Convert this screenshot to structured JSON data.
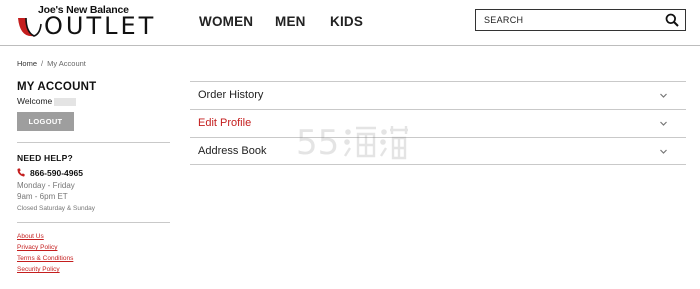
{
  "brand": {
    "line1": "Joe's New Balance",
    "line2": "OUTLET",
    "accent_color": "#c41e1e"
  },
  "nav": {
    "items": [
      {
        "label": "WOMEN"
      },
      {
        "label": "MEN"
      },
      {
        "label": "KIDS"
      }
    ]
  },
  "search": {
    "placeholder": "SEARCH",
    "icon": "search-icon"
  },
  "breadcrumb": {
    "home": "Home",
    "separator": "/",
    "current": "My Account"
  },
  "sidebar": {
    "title": "MY ACCOUNT",
    "welcome": "Welcome",
    "logout_label": "LOGOUT",
    "help_title": "NEED HELP?",
    "phone": "866-590-4965",
    "hours_days": "Monday - Friday",
    "hours_time": "9am - 6pm ET",
    "closed": "Closed Saturday & Sunday",
    "links": [
      {
        "label": "About Us"
      },
      {
        "label": "Privacy Policy"
      },
      {
        "label": "Terms & Conditions"
      },
      {
        "label": "Security Policy"
      }
    ]
  },
  "sections": [
    {
      "label": "Order History",
      "active": false
    },
    {
      "label": "Edit Profile",
      "active": true
    },
    {
      "label": "Address Book",
      "active": false
    }
  ],
  "watermark": {
    "digits": "55",
    "icon": "watermark-55haitao-logo"
  }
}
